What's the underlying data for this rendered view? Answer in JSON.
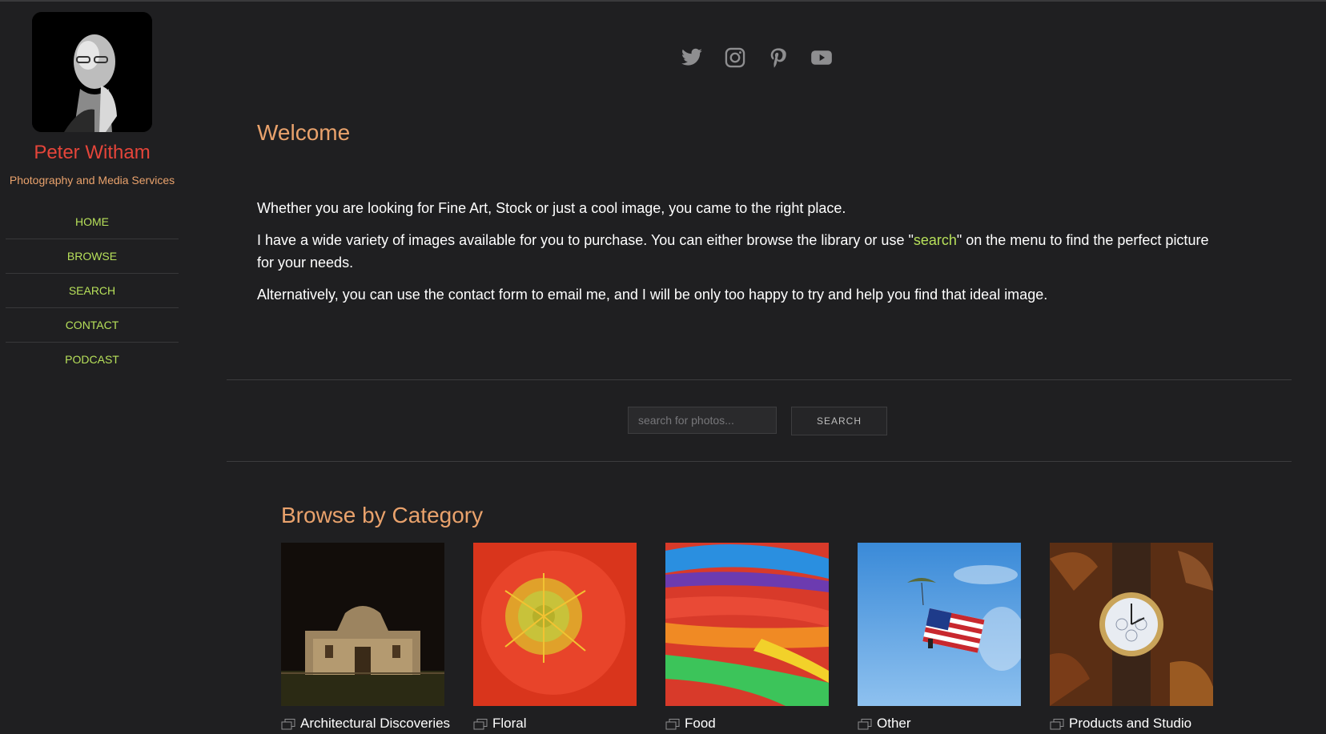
{
  "sidebar": {
    "name": "Peter Witham",
    "tagline": "Photography and Media Services",
    "nav": [
      {
        "label": "HOME"
      },
      {
        "label": "BROWSE"
      },
      {
        "label": "SEARCH"
      },
      {
        "label": "CONTACT"
      },
      {
        "label": "PODCAST"
      }
    ]
  },
  "social": [
    "twitter-icon",
    "instagram-icon",
    "pinterest-icon",
    "youtube-icon"
  ],
  "welcome": {
    "title": "Welcome",
    "p1": "Whether you are looking for Fine Art, Stock or just a cool image, you came to the right place.",
    "p2_before": "I have a wide variety of images available for you to purchase. You can either browse the library or use \"",
    "p2_link": "search",
    "p2_after": "\" on the menu to find the perfect picture for your needs.",
    "p3": "Alternatively, you can use the contact form to email me, and I will be only too happy to try and help you find that ideal image."
  },
  "search": {
    "placeholder": "search for photos...",
    "button": "SEARCH"
  },
  "browse": {
    "title": "Browse by Category",
    "categories": [
      {
        "label": "Architectural Discoveries"
      },
      {
        "label": "Floral"
      },
      {
        "label": "Food"
      },
      {
        "label": "Other"
      },
      {
        "label": "Products and Studio"
      }
    ]
  },
  "colors": {
    "background": "#1f1f21",
    "accent_orange": "#e9a26c",
    "name_red": "#e5453a",
    "nav_green": "#b7e05a"
  }
}
